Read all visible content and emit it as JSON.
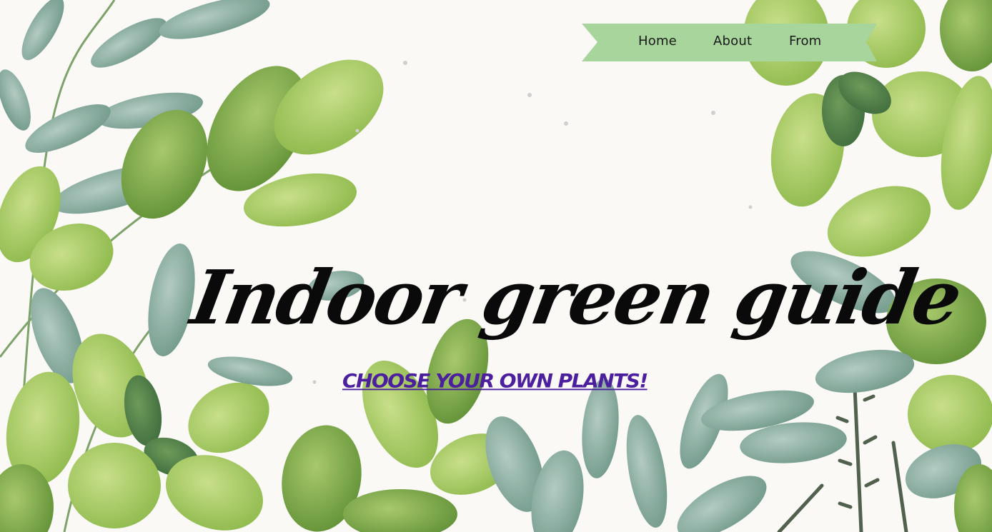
{
  "nav": {
    "items": [
      {
        "label": "Home"
      },
      {
        "label": "About"
      },
      {
        "label": "From"
      }
    ],
    "ribbon_color": "#a8d59b"
  },
  "hero": {
    "title": "Indoor green guide",
    "cta_label": "CHOOSE YOUR OWN PLANTS!"
  },
  "colors": {
    "background": "#faf9f6",
    "cta": "#4b1f9e",
    "title": "#0a0a0a",
    "leaf_light": "#9cc25a",
    "leaf_mid": "#6f9f3e",
    "leaf_teal": "#7fa89a"
  }
}
